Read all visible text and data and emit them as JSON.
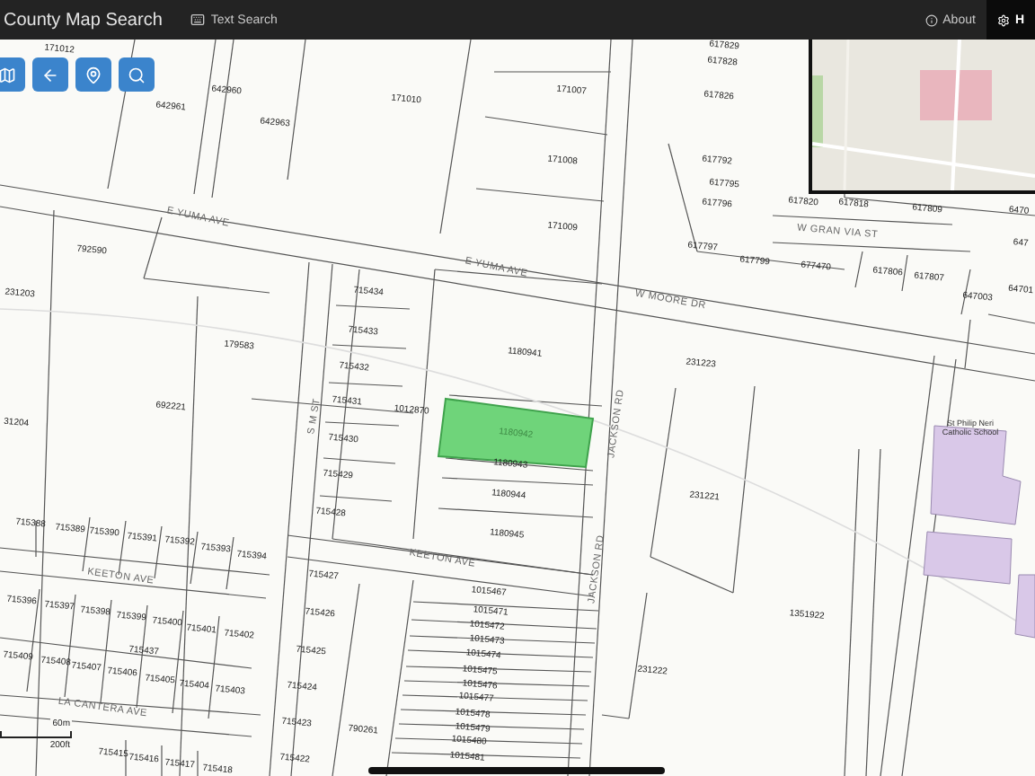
{
  "navbar": {
    "title": "County Map Search",
    "links": [
      {
        "label": "Text Search",
        "kind": "text-search",
        "selected": false
      },
      {
        "label": "About",
        "kind": "about",
        "selected": false
      },
      {
        "label": "H",
        "kind": "help",
        "selected": true
      }
    ]
  },
  "toolbar": [
    {
      "kind": "layers"
    },
    {
      "kind": "back"
    },
    {
      "kind": "locate"
    },
    {
      "kind": "search"
    }
  ],
  "map": {
    "selected_parcel": {
      "label": "1180942"
    },
    "parcels": [
      "171012",
      "642960",
      "642961",
      "642963",
      "171010",
      "171007",
      "171008",
      "171009",
      "617829",
      "617828",
      "617826",
      "617792",
      "617795",
      "617796",
      "617797",
      "617799",
      "617820",
      "617818",
      "617809",
      "677470",
      "617806",
      "617807",
      "6470",
      "647",
      "64701",
      "647003",
      "792590",
      "231203",
      "715434",
      "715433",
      "715432",
      "179583",
      "1180941",
      "231223",
      "692221",
      "31204",
      "715431",
      "1012870",
      "715430",
      "715429",
      "715428",
      "1180943",
      "1180944",
      "1180945",
      "231221",
      "1351922",
      "231222",
      "715388",
      "715389",
      "715390",
      "715391",
      "715392",
      "715393",
      "715394",
      "715396",
      "715397",
      "715398",
      "715399",
      "715400",
      "715401",
      "715402",
      "715437",
      "715409",
      "715408",
      "715407",
      "715406",
      "715405",
      "715404",
      "715403",
      "715415",
      "715416",
      "715417",
      "715418",
      "715427",
      "715426",
      "715425",
      "715424",
      "715423",
      "715422",
      "790261",
      "1015467",
      "1015471",
      "1015472",
      "1015473",
      "1015474",
      "1015475",
      "1015476",
      "1015477",
      "1015478",
      "1015479",
      "1015480",
      "1015481"
    ],
    "streets": [
      "E YUMA AVE",
      "E YUMA AVE",
      "W MOORE DR",
      "W GRAN VIA ST",
      "S M ST",
      "KEETON AVE",
      "KEETON AVE",
      "LA CANTERA AVE",
      "JACKSON RD",
      "JACKSON RD"
    ],
    "school": {
      "label": "St Philip Neri Catholic School"
    },
    "scale": {
      "metric": "60m",
      "imperial": "200ft"
    }
  }
}
